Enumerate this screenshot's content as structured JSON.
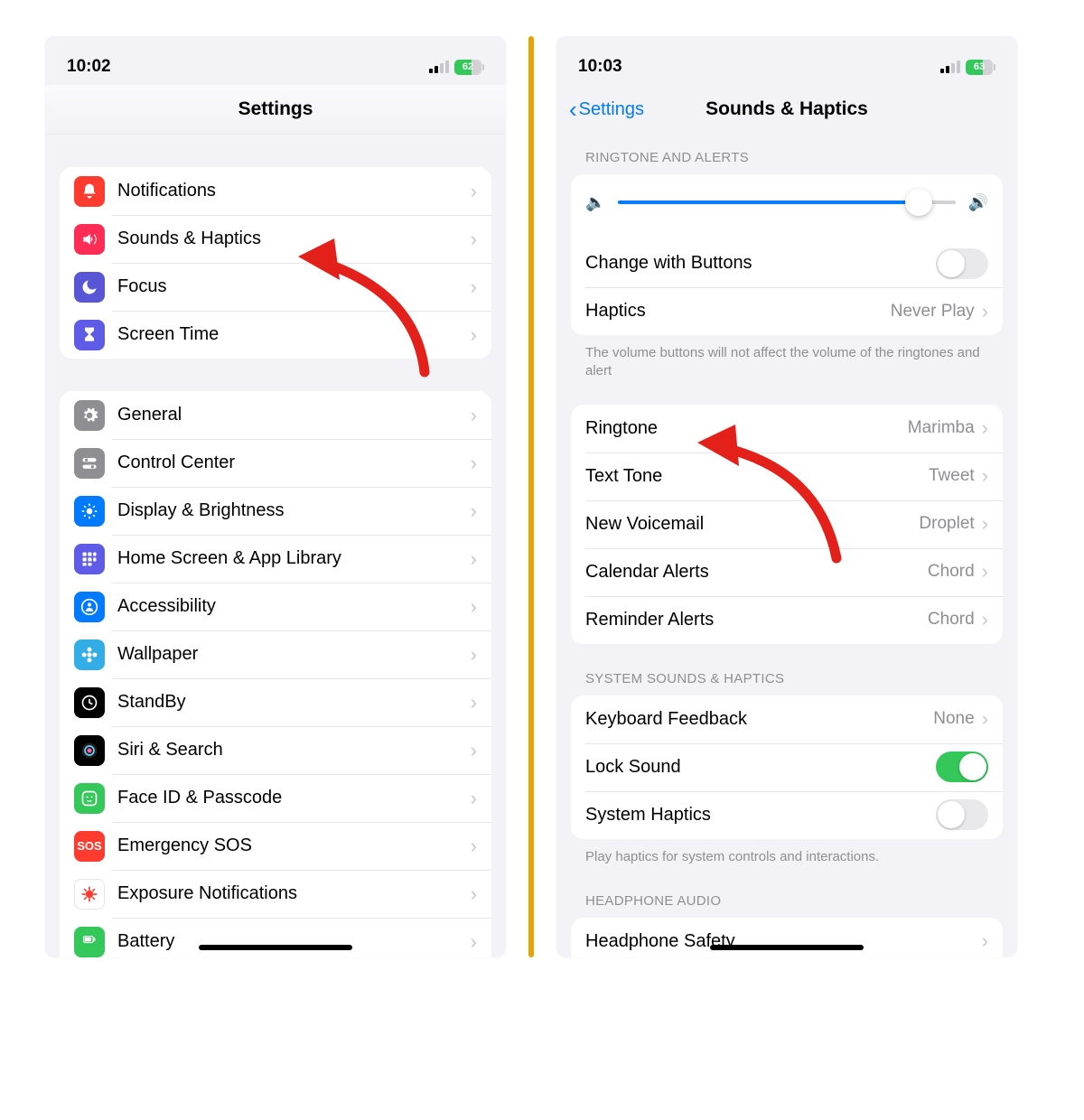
{
  "left": {
    "status": {
      "time": "10:02",
      "battery": "62"
    },
    "title": "Settings",
    "group1": [
      {
        "name": "notifications",
        "label": "Notifications",
        "color": "c-red",
        "glyph": "bell"
      },
      {
        "name": "sounds-haptics",
        "label": "Sounds & Haptics",
        "color": "c-pink",
        "glyph": "speaker"
      },
      {
        "name": "focus",
        "label": "Focus",
        "color": "c-purple",
        "glyph": "moon"
      },
      {
        "name": "screen-time",
        "label": "Screen Time",
        "color": "c-indigo",
        "glyph": "hourglass"
      }
    ],
    "group2": [
      {
        "name": "general",
        "label": "General",
        "color": "c-gray",
        "glyph": "gear"
      },
      {
        "name": "control-center",
        "label": "Control Center",
        "color": "c-gray",
        "glyph": "switches"
      },
      {
        "name": "display-brightness",
        "label": "Display & Brightness",
        "color": "c-blue",
        "glyph": "sun"
      },
      {
        "name": "home-screen",
        "label": "Home Screen & App Library",
        "color": "c-indigo",
        "glyph": "grid"
      },
      {
        "name": "accessibility",
        "label": "Accessibility",
        "color": "c-blue",
        "glyph": "person"
      },
      {
        "name": "wallpaper",
        "label": "Wallpaper",
        "color": "c-cyan",
        "glyph": "flower"
      },
      {
        "name": "standby",
        "label": "StandBy",
        "color": "c-black",
        "glyph": "clock"
      },
      {
        "name": "siri",
        "label": "Siri & Search",
        "color": "c-black",
        "glyph": "siri"
      },
      {
        "name": "faceid",
        "label": "Face ID & Passcode",
        "color": "c-green",
        "glyph": "face"
      },
      {
        "name": "emergency-sos",
        "label": "Emergency SOS",
        "color": "c-red",
        "glyph": "sos"
      },
      {
        "name": "exposure",
        "label": "Exposure Notifications",
        "color": "c-white",
        "glyph": "virus"
      },
      {
        "name": "battery",
        "label": "Battery",
        "color": "c-green",
        "glyph": "battery"
      }
    ]
  },
  "right": {
    "status": {
      "time": "10:03",
      "battery": "63"
    },
    "back": "Settings",
    "title": "Sounds & Haptics",
    "section1_header": "RINGTONE AND ALERTS",
    "change_buttons": "Change with Buttons",
    "haptics_label": "Haptics",
    "haptics_value": "Never Play",
    "footer1": "The volume buttons will not affect the volume of the ringtones and alert",
    "tones": [
      {
        "name": "ringtone",
        "label": "Ringtone",
        "value": "Marimba"
      },
      {
        "name": "text-tone",
        "label": "Text Tone",
        "value": "Tweet"
      },
      {
        "name": "new-voicemail",
        "label": "New Voicemail",
        "value": "Droplet"
      },
      {
        "name": "calendar-alerts",
        "label": "Calendar Alerts",
        "value": "Chord"
      },
      {
        "name": "reminder-alerts",
        "label": "Reminder Alerts",
        "value": "Chord"
      }
    ],
    "section2_header": "SYSTEM SOUNDS & HAPTICS",
    "keyboard_feedback_label": "Keyboard Feedback",
    "keyboard_feedback_value": "None",
    "lock_sound": "Lock Sound",
    "system_haptics": "System Haptics",
    "footer2": "Play haptics for system controls and interactions.",
    "section3_header": "HEADPHONE AUDIO",
    "headphone_safety": "Headphone Safety"
  },
  "colors": {
    "accent": "#007aff",
    "green": "#34c759",
    "arrow": "#e4201a"
  }
}
